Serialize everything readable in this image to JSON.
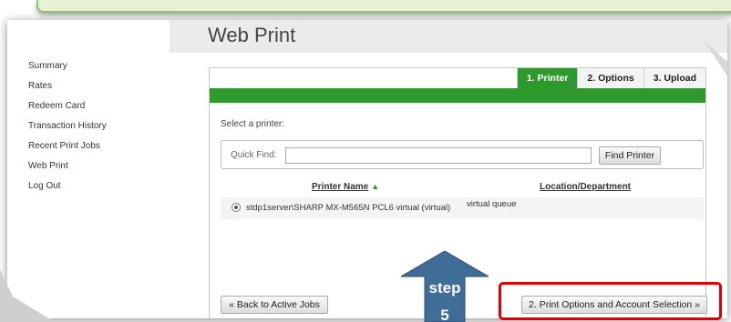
{
  "page_title": "Web Print",
  "sidebar": {
    "items": [
      {
        "label": "Summary"
      },
      {
        "label": "Rates"
      },
      {
        "label": "Redeem Card"
      },
      {
        "label": "Transaction History"
      },
      {
        "label": "Recent Print Jobs"
      },
      {
        "label": "Web Print"
      },
      {
        "label": "Log Out"
      }
    ]
  },
  "tabs": [
    {
      "label": "1. Printer",
      "active": true
    },
    {
      "label": "2. Options",
      "active": false
    },
    {
      "label": "3. Upload",
      "active": false
    }
  ],
  "select_label": "Select a printer:",
  "quick_find": {
    "label": "Quick Find:",
    "value": "",
    "button_label": "Find Printer"
  },
  "table": {
    "headers": {
      "name": "Printer Name",
      "location": "Location/Department"
    },
    "rows": [
      {
        "name": "stdp1server\\SHARP MX-M565N PCL6 virtual (virtual)",
        "location": "virtual queue",
        "selected": true
      }
    ]
  },
  "buttons": {
    "back": "« Back to Active Jobs",
    "next": "2. Print Options and Account Selection »"
  },
  "annotation": {
    "step_line1": "step",
    "step_line2": "5"
  },
  "colors": {
    "accent_green": "#2e9a2e",
    "highlight_red": "#e00000",
    "arrow_blue": "#3f6d95"
  }
}
